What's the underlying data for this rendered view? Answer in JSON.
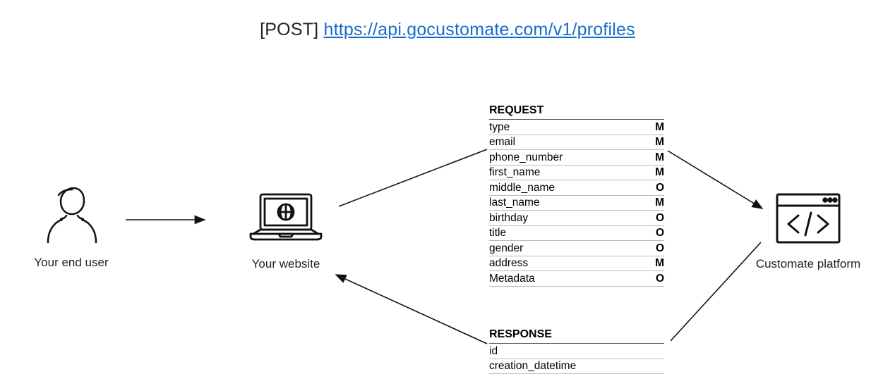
{
  "header": {
    "method": "[POST]",
    "url": "https://api.gocustomate.com/v1/profiles"
  },
  "nodes": {
    "user": {
      "label": "Your end user"
    },
    "website": {
      "label": "Your website"
    },
    "platform": {
      "label": "Customate platform"
    }
  },
  "request": {
    "title": "REQUEST",
    "fields": [
      {
        "name": "type",
        "required": "M"
      },
      {
        "name": "email",
        "required": "M"
      },
      {
        "name": "phone_number",
        "required": "M"
      },
      {
        "name": "first_name",
        "required": "M"
      },
      {
        "name": "middle_name",
        "required": "O"
      },
      {
        "name": "last_name",
        "required": "M"
      },
      {
        "name": "birthday",
        "required": "O"
      },
      {
        "name": "title",
        "required": "O"
      },
      {
        "name": "gender",
        "required": "O"
      },
      {
        "name": "address",
        "required": "M"
      },
      {
        "name": "Metadata",
        "required": "O"
      }
    ]
  },
  "response": {
    "title": "RESPONSE",
    "fields": [
      {
        "name": "id"
      },
      {
        "name": "creation_datetime"
      }
    ]
  }
}
